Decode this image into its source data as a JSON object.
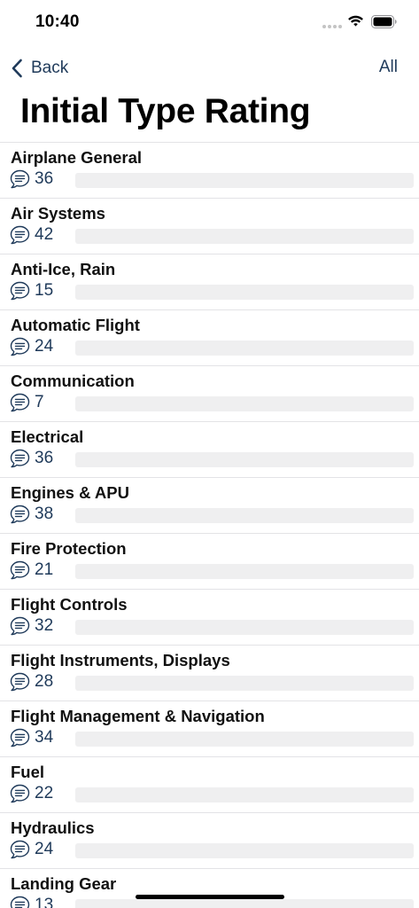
{
  "status_bar": {
    "time": "10:40"
  },
  "nav": {
    "back_label": "Back",
    "right_label": "All"
  },
  "title": "Initial Type Rating",
  "colors": {
    "accent": "#1f3a5a",
    "track": "#efeff0",
    "separator": "#e3e3e6"
  },
  "icons": {
    "list_item_icon": "chat-bubble-lines-icon",
    "back_icon": "chevron-left-icon"
  },
  "items": [
    {
      "title": "Airplane General",
      "count": "36",
      "progress": 0
    },
    {
      "title": "Air Systems",
      "count": "42",
      "progress": 0
    },
    {
      "title": "Anti-Ice, Rain",
      "count": "15",
      "progress": 0
    },
    {
      "title": "Automatic Flight",
      "count": "24",
      "progress": 0
    },
    {
      "title": "Communication",
      "count": "7",
      "progress": 0
    },
    {
      "title": "Electrical",
      "count": "36",
      "progress": 0
    },
    {
      "title": "Engines & APU",
      "count": "38",
      "progress": 0
    },
    {
      "title": "Fire Protection",
      "count": "21",
      "progress": 0
    },
    {
      "title": "Flight Controls",
      "count": "32",
      "progress": 0
    },
    {
      "title": "Flight Instruments, Displays",
      "count": "28",
      "progress": 0
    },
    {
      "title": "Flight Management & Navigation",
      "count": "34",
      "progress": 0
    },
    {
      "title": "Fuel",
      "count": "22",
      "progress": 0
    },
    {
      "title": "Hydraulics",
      "count": "24",
      "progress": 0
    },
    {
      "title": "Landing Gear",
      "count": "13",
      "progress": 0
    }
  ]
}
